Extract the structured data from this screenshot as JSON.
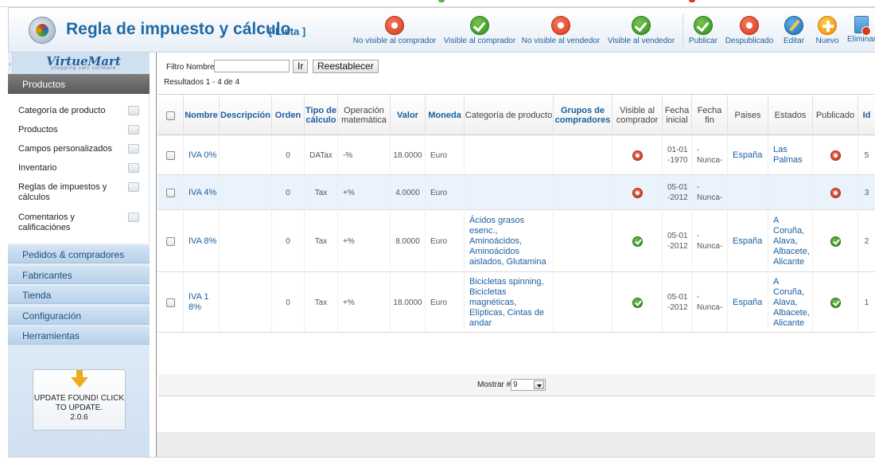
{
  "header": {
    "title": "Regla de impuesto y cálculo",
    "subtitle": "[ Lista ]",
    "toolbar": [
      {
        "name": "no-visible-comprador-button",
        "icon": "red-circle-icon",
        "label": "No visible al comprador"
      },
      {
        "name": "visible-comprador-button",
        "icon": "green-check-icon",
        "label": "Visible al comprador"
      },
      {
        "name": "no-visible-vendedor-button",
        "icon": "red-circle-icon",
        "label": "No visible al vendedor"
      },
      {
        "name": "visible-vendedor-button",
        "icon": "green-check-icon",
        "label": "Visible al vendedor"
      },
      {
        "name": "publicar-button",
        "icon": "green-check-icon",
        "label": "Publicar"
      },
      {
        "name": "despublicado-button",
        "icon": "red-circle-icon",
        "label": "Despublicado"
      },
      {
        "name": "editar-button",
        "icon": "pencil-icon",
        "label": "Editar"
      },
      {
        "name": "nuevo-button",
        "icon": "plus-icon",
        "label": "Nuevo"
      },
      {
        "name": "eliminar-button",
        "icon": "trash-icon",
        "label": "Eliminar"
      }
    ]
  },
  "sidebar": {
    "logo": "VirtueMart",
    "logo_tagline": "shopping cart software",
    "active_section": "Productos",
    "sub_items": [
      {
        "label": "Categoría de producto",
        "icon": "category-icon"
      },
      {
        "label": "Productos",
        "icon": "products-icon"
      },
      {
        "label": "Campos personalizados",
        "icon": "custom-fields-icon"
      },
      {
        "label": "Inventario",
        "icon": "inventory-icon"
      },
      {
        "label": "Reglas de impuestos y cálculos",
        "icon": "tax-rules-icon"
      },
      {
        "label": "Comentarios y calificaciónes",
        "icon": "comments-icon"
      }
    ],
    "sections": [
      "Pedidos & compradores",
      "Fabricantes",
      "Tienda",
      "Configuración",
      "Herramientas"
    ],
    "update_notice": "UPDATE FOUND! CLICK TO UPDATE.",
    "update_version": "2.0.6"
  },
  "filter": {
    "label": "Filtro Nombre:",
    "value": "",
    "go_button": "Ir",
    "reset_button": "Reestablecer",
    "results": "Resultados 1 - 4 de 4"
  },
  "table": {
    "columns": [
      "Nombre",
      "Descripción",
      "Orden",
      "Tipo de cálculo",
      "Operación matemática",
      "Valor",
      "Moneda",
      "Categoría de producto",
      "Grupos de compradores",
      "Visible al comprador",
      "Fecha inicial",
      "Fecha fin",
      "Paises",
      "Estados",
      "Publicado",
      "Id"
    ],
    "rows": [
      {
        "nombre": "IVA 0%",
        "descripcion": "",
        "orden": "0",
        "tipo": "DATax",
        "operacion": "-%",
        "valor": "18.0000",
        "moneda": "Euro",
        "categoria": "",
        "grupos": "",
        "visible": "off",
        "fecha_inicial": "01-01-1970",
        "fecha_fin": "-Nunca-",
        "paises": "España",
        "estados": "Las Palmas",
        "publicado": "off",
        "id": "5"
      },
      {
        "nombre": "IVA 4%",
        "descripcion": "",
        "orden": "0",
        "tipo": "Tax",
        "operacion": "+%",
        "valor": "4.0000",
        "moneda": "Euro",
        "categoria": "",
        "grupos": "",
        "visible": "off",
        "fecha_inicial": "05-01-2012",
        "fecha_fin": "-Nunca-",
        "paises": "",
        "estados": "",
        "publicado": "off",
        "id": "3"
      },
      {
        "nombre": "IVA 8%",
        "descripcion": "",
        "orden": "0",
        "tipo": "Tax",
        "operacion": "+%",
        "valor": "8.0000",
        "moneda": "Euro",
        "categoria": "Ácidos grasos esenc., Aminoácidos, Aminoácidos aislados, Glutamina",
        "grupos": "",
        "visible": "on",
        "fecha_inicial": "05-01-2012",
        "fecha_fin": "-Nunca-",
        "paises": "España",
        "estados": "A Coruña, Alava, Albacete, Alicante",
        "publicado": "on",
        "id": "2"
      },
      {
        "nombre": "IVA 18%",
        "descripcion": "",
        "orden": "0",
        "tipo": "Tax",
        "operacion": "+%",
        "valor": "18.0000",
        "moneda": "Euro",
        "categoria": "Bicicletas spinning, Bicicletas magnéticas, Elípticas, Cintas de andar",
        "grupos": "",
        "visible": "on",
        "fecha_inicial": "05-01-2012",
        "fecha_fin": "-Nunca-",
        "paises": "España",
        "estados": "A Coruña, Alava, Albacete, Alicante",
        "publicado": "on",
        "id": "1"
      }
    ]
  },
  "pagination": {
    "label": "Mostrar #",
    "value": "9"
  },
  "colors": {
    "accent": "#1f6aa5",
    "link": "#1a5fa0",
    "row_alt": "#eaf3fc",
    "sidebar": "#cfe0f1"
  }
}
